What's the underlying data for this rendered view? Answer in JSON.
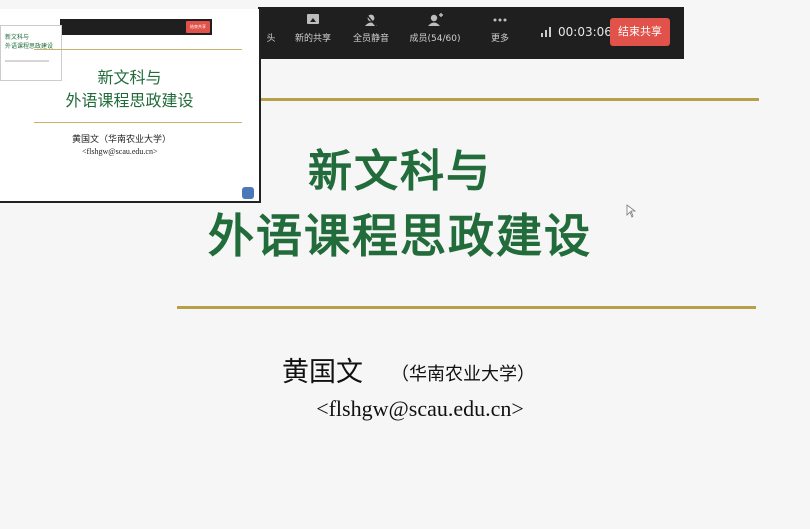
{
  "toolbar": {
    "items": [
      {
        "label": "头",
        "icon": "camera-icon"
      },
      {
        "label": "新的共享",
        "icon": "share-screen-icon"
      },
      {
        "label": "全员静音",
        "icon": "mute-all-icon"
      },
      {
        "label": "成员(54/60)",
        "icon": "members-icon"
      },
      {
        "label": "更多",
        "icon": "more-icon"
      }
    ],
    "timer": "00:03:06",
    "stop_share_label": "结束共享",
    "stop_color": "#e0524a"
  },
  "slide": {
    "title_line1": "新文科与",
    "title_line2": "外语课程思政建设",
    "author": "黄国文",
    "affiliation": "（华南农业大学）",
    "email": "<flshgw@scau.edu.cn>",
    "title_color": "#226b3b",
    "rule_color": "#b8a04a"
  },
  "preview": {
    "stop_label": "结束共享",
    "mini_title": "新文科与\n外语课程思政建设",
    "title_line1": "新文科与",
    "title_line2": "外语课程思政建设",
    "author": "黄国文（华南农业大学）",
    "email": "<flshgw@scau.edu.cn>"
  }
}
